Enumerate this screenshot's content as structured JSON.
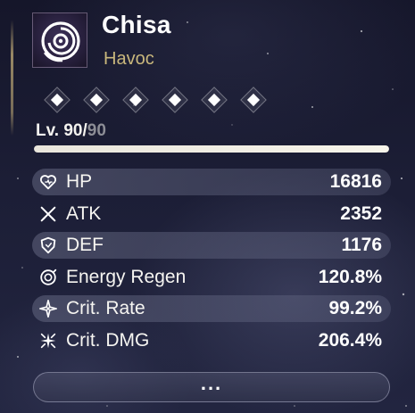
{
  "character": {
    "name": "Chisa",
    "element": "Havoc",
    "element_icon": "havoc-icon",
    "accent_color": "#c9b77c"
  },
  "sequence": {
    "nodes": [
      "sequence-node-1",
      "sequence-node-2",
      "sequence-node-3",
      "sequence-node-4",
      "sequence-node-5",
      "sequence-node-6"
    ]
  },
  "level": {
    "prefix": "Lv.",
    "current": "90",
    "separator": "/",
    "max": "90",
    "progress": 1.0
  },
  "stats": [
    {
      "key": "hp",
      "label": "HP",
      "value": "16816",
      "icon": "heart-icon",
      "shaded": true
    },
    {
      "key": "atk",
      "label": "ATK",
      "value": "2352",
      "icon": "crossed-swords-icon",
      "shaded": false
    },
    {
      "key": "def",
      "label": "DEF",
      "value": "1176",
      "icon": "shield-icon",
      "shaded": true
    },
    {
      "key": "energy-regen",
      "label": "Energy Regen",
      "value": "120.8%",
      "icon": "energy-regen-icon",
      "shaded": false
    },
    {
      "key": "crit-rate",
      "label": "Crit. Rate",
      "value": "99.2%",
      "icon": "crit-rate-icon",
      "shaded": true
    },
    {
      "key": "crit-dmg",
      "label": "Crit. DMG",
      "value": "206.4%",
      "icon": "crit-dmg-icon",
      "shaded": false
    }
  ],
  "more_button": {
    "label": "...",
    "icon": "ellipsis-icon"
  }
}
